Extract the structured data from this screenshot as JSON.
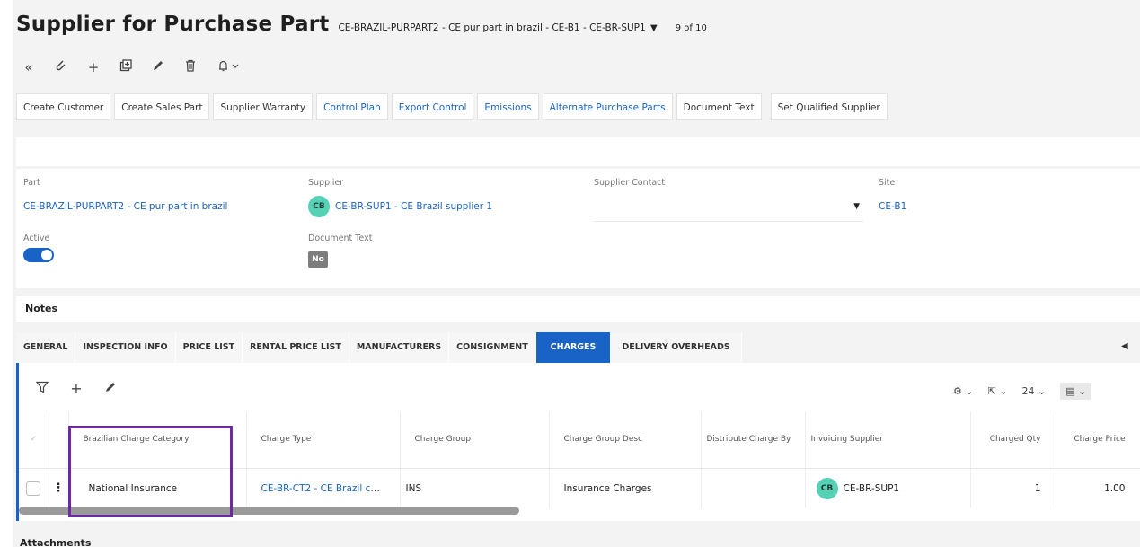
{
  "header": {
    "title": "Supplier for Purchase Part",
    "record_id": "CE-BRAZIL-PURPART2 - CE pur part in brazil - CE-B1 - CE-BR-SUP1",
    "record_count": "9 of 10"
  },
  "toolbar": {
    "icons": [
      "collapse-icon",
      "attach-icon",
      "add-icon",
      "duplicate-icon",
      "edit-icon",
      "delete-icon",
      "notification-icon"
    ]
  },
  "commands": [
    {
      "label": "Create Customer",
      "link": false
    },
    {
      "label": "Create Sales Part",
      "link": false
    },
    {
      "label": "Supplier Warranty",
      "link": false
    },
    {
      "label": "Control Plan",
      "link": true
    },
    {
      "label": "Export Control",
      "link": true
    },
    {
      "label": "Emissions",
      "link": true
    },
    {
      "label": "Alternate Purchase Parts",
      "link": true
    },
    {
      "label": "Document Text",
      "link": false
    },
    {
      "label": "Set Qualified Supplier",
      "link": false
    }
  ],
  "form": {
    "part_label": "Part",
    "part_value": "CE-BRAZIL-PURPART2 - CE pur part in brazil",
    "supplier_label": "Supplier",
    "supplier_avatar": "CB",
    "supplier_value": "CE-BR-SUP1 - CE Brazil supplier 1",
    "contact_label": "Supplier Contact",
    "contact_value": "",
    "site_label": "Site",
    "site_value": "CE-B1",
    "active_label": "Active",
    "active_on": true,
    "doc_text_label": "Document Text",
    "doc_text_value": "No"
  },
  "notes": {
    "label": "Notes"
  },
  "tabs": [
    {
      "label": "GENERAL",
      "active": false
    },
    {
      "label": "INSPECTION INFO",
      "active": false
    },
    {
      "label": "PRICE LIST",
      "active": false
    },
    {
      "label": "RENTAL PRICE LIST",
      "active": false
    },
    {
      "label": "MANUFACTURERS",
      "active": false
    },
    {
      "label": "CONSIGNMENT",
      "active": false
    },
    {
      "label": "CHARGES",
      "active": true
    },
    {
      "label": "DELIVERY OVERHEADS",
      "active": false
    }
  ],
  "grid": {
    "page_size": "24",
    "columns": [
      "Brazilian Charge Category",
      "Charge Type",
      "Charge Group",
      "Charge Group Desc",
      "Distribute Charge By",
      "Invoicing Supplier",
      "Charged Qty",
      "Charge Price"
    ],
    "rows": [
      {
        "brazilian_charge_category": "National Insurance",
        "charge_type": "CE-BR-CT2 - CE Brazil ch...",
        "charge_group": "INS",
        "charge_group_desc": "Insurance Charges",
        "distribute_charge_by": "",
        "invoicing_supplier_avatar": "CB",
        "invoicing_supplier": "CE-BR-SUP1",
        "charged_qty": "1",
        "charge_price": "1.00"
      }
    ]
  },
  "attachments": {
    "label": "Attachments"
  },
  "colors": {
    "accent": "#1a63c6",
    "highlight": "#6c2aa5",
    "avatar": "#55d1b6"
  }
}
